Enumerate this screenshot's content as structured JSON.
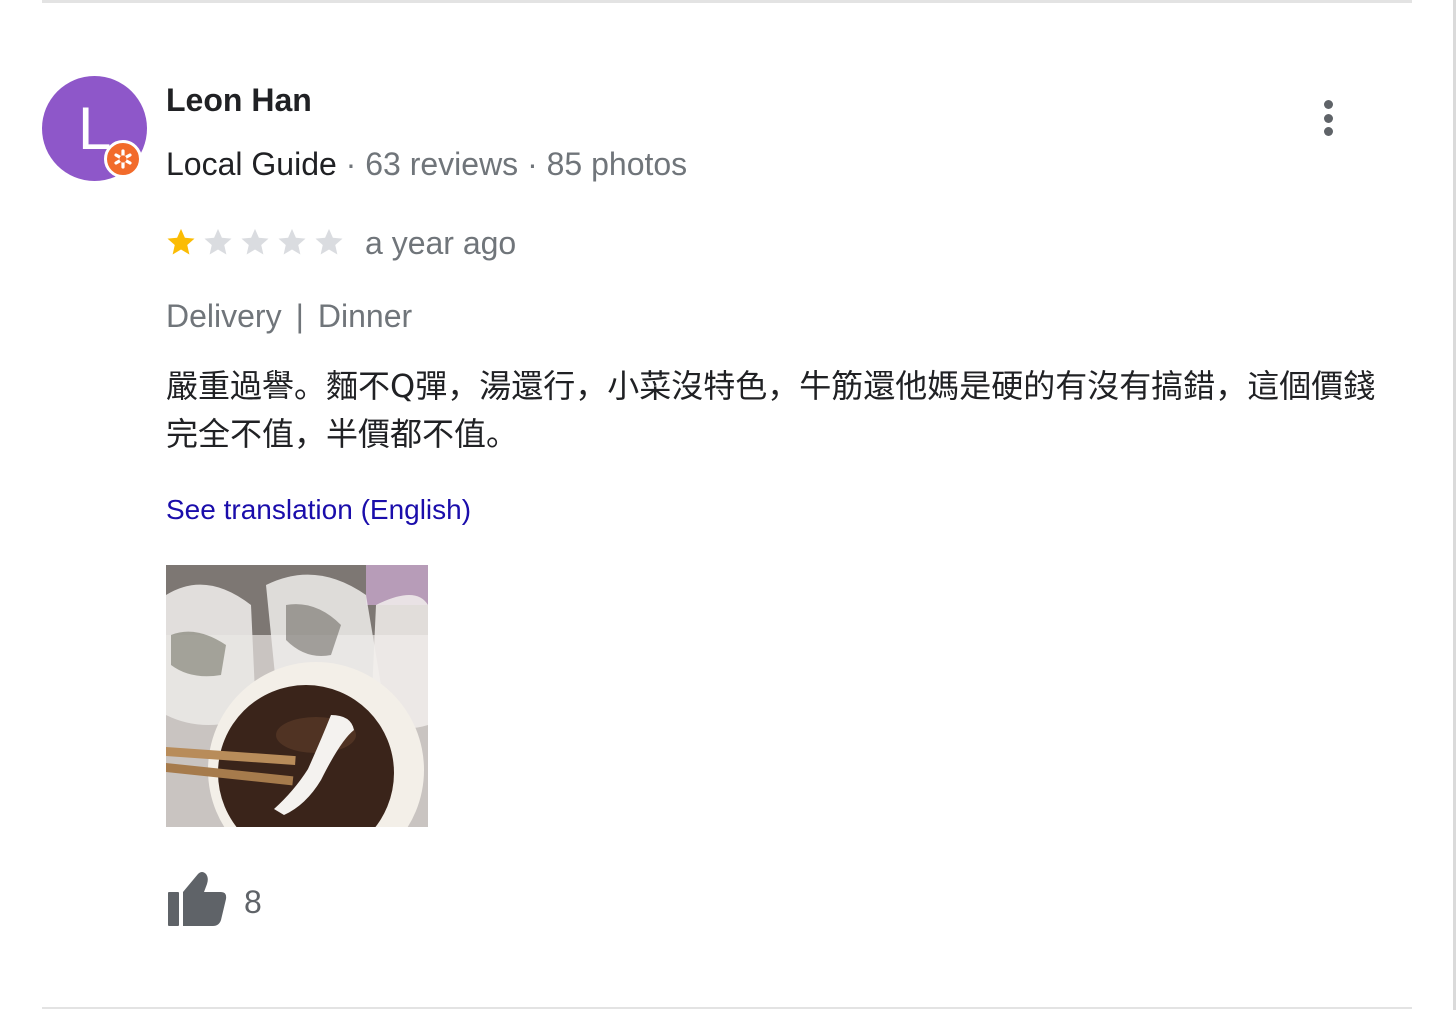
{
  "reviewer": {
    "avatar_letter": "L",
    "avatar_color": "#8e57c9",
    "badge_color": "#f26b2b",
    "name": "Leon Han",
    "badge_label": "Local Guide",
    "reviews_count": "63 reviews",
    "photos_count": "85 photos"
  },
  "review": {
    "rating": 1,
    "max_rating": 5,
    "star_filled_color": "#fbbc04",
    "star_empty_color": "#dadce0",
    "time_ago": "a year ago",
    "tags": [
      "Delivery",
      "Dinner"
    ],
    "text": "嚴重過譽。麵不Q彈，湯還行，小菜沒特色，牛筋還他媽是硬的有沒有搞錯，這個價錢完全不值，半價都不值。",
    "translation_link": "See translation (English)",
    "photo_icon": "food-photo",
    "like_count": "8"
  },
  "icons": {
    "more": "more-vert-icon",
    "like": "thumb-up-icon",
    "badge": "local-guide-badge-icon"
  }
}
